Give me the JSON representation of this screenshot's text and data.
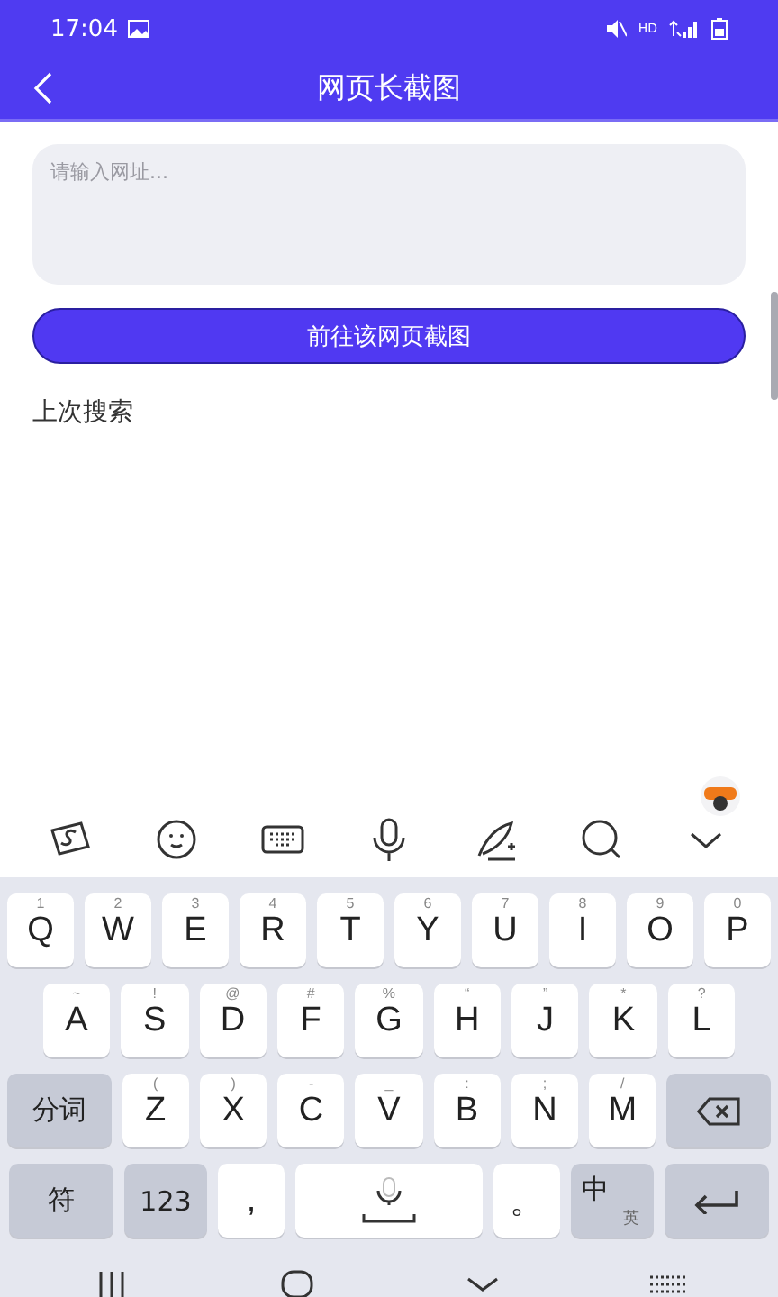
{
  "status_bar": {
    "time": "17:04",
    "network": "HD"
  },
  "app_bar": {
    "title": "网页长截图"
  },
  "url_field": {
    "placeholder": "请输入网址..."
  },
  "go_button": {
    "label": "前往该网页截图"
  },
  "history": {
    "title": "上次搜索"
  },
  "keyboard": {
    "rows": [
      {
        "keys": [
          {
            "kind": "char",
            "label": "Q",
            "hint": "1"
          },
          {
            "kind": "char",
            "label": "W",
            "hint": "2"
          },
          {
            "kind": "char",
            "label": "E",
            "hint": "3"
          },
          {
            "kind": "char",
            "label": "R",
            "hint": "4"
          },
          {
            "kind": "char",
            "label": "T",
            "hint": "5"
          },
          {
            "kind": "char",
            "label": "Y",
            "hint": "6"
          },
          {
            "kind": "char",
            "label": "U",
            "hint": "7"
          },
          {
            "kind": "char",
            "label": "I",
            "hint": "8"
          },
          {
            "kind": "char",
            "label": "O",
            "hint": "9"
          },
          {
            "kind": "char",
            "label": "P",
            "hint": "0"
          }
        ]
      },
      {
        "keys": [
          {
            "kind": "char",
            "label": "A",
            "hint": "~"
          },
          {
            "kind": "char",
            "label": "S",
            "hint": "!"
          },
          {
            "kind": "char",
            "label": "D",
            "hint": "@"
          },
          {
            "kind": "char",
            "label": "F",
            "hint": "#"
          },
          {
            "kind": "char",
            "label": "G",
            "hint": "%"
          },
          {
            "kind": "char",
            "label": "H",
            "hint": "“"
          },
          {
            "kind": "char",
            "label": "J",
            "hint": "”"
          },
          {
            "kind": "char",
            "label": "K",
            "hint": "*"
          },
          {
            "kind": "char",
            "label": "L",
            "hint": "?"
          }
        ]
      },
      {
        "keys": [
          {
            "kind": "func",
            "label": "分词"
          },
          {
            "kind": "char",
            "label": "Z",
            "hint": "("
          },
          {
            "kind": "char",
            "label": "X",
            "hint": ")"
          },
          {
            "kind": "char",
            "label": "C",
            "hint": "-"
          },
          {
            "kind": "char",
            "label": "V",
            "hint": "_"
          },
          {
            "kind": "char",
            "label": "B",
            "hint": ":"
          },
          {
            "kind": "char",
            "label": "N",
            "hint": ";"
          },
          {
            "kind": "char",
            "label": "M",
            "hint": "/"
          },
          {
            "kind": "delete"
          }
        ]
      },
      {
        "keys": [
          {
            "kind": "func",
            "label": "符"
          },
          {
            "kind": "func",
            "label": "123"
          },
          {
            "kind": "char",
            "label": ","
          },
          {
            "kind": "space"
          },
          {
            "kind": "char",
            "label": "。"
          },
          {
            "kind": "lang",
            "label": "中",
            "sub": "英"
          },
          {
            "kind": "enter"
          }
        ]
      }
    ]
  }
}
